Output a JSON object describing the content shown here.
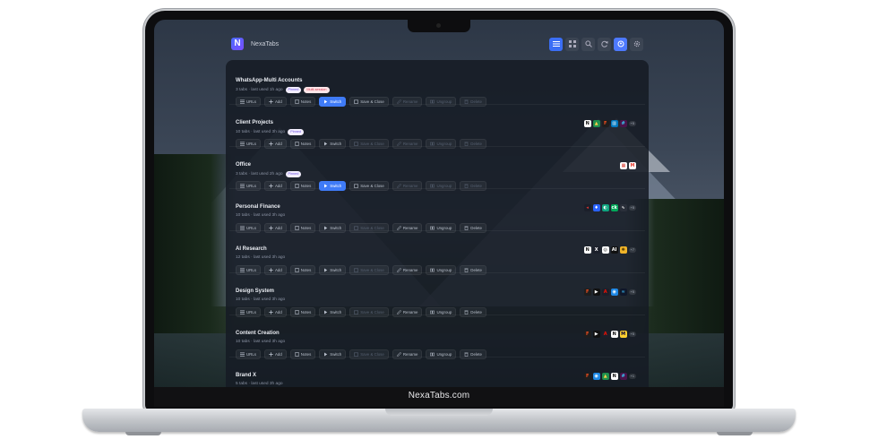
{
  "app": {
    "name": "NexaTabs",
    "logo_letter": "N",
    "footer_text": "NexaTabs.com"
  },
  "toolbar": {
    "buttons": [
      {
        "icon": "list-icon",
        "active": true
      },
      {
        "icon": "grid-icon",
        "active": false
      },
      {
        "icon": "search-icon",
        "active": false
      },
      {
        "icon": "refresh-icon",
        "active": false
      },
      {
        "icon": "profile-icon",
        "active": true
      },
      {
        "icon": "gear-icon",
        "active": false
      }
    ]
  },
  "actions": {
    "urls": "URLs",
    "add": "Add",
    "notes": "Notes",
    "switch": "Switch",
    "save_close": "Save & Close",
    "rename": "Rename",
    "ungroup": "Ungroup",
    "delete": "Delete"
  },
  "groups": [
    {
      "name": "WhatsApp-Multi Accounts",
      "meta": "3 tabs · last used 1h ago",
      "badges": [
        "Pinned",
        "Multi-session"
      ],
      "state": "active",
      "apps": [],
      "more": ""
    },
    {
      "name": "Client Projects",
      "meta": "10 tabs · last used 3h ago",
      "badges": [
        "Pinned"
      ],
      "state": "inactive",
      "apps": [
        "notion",
        "google-drive",
        "figma",
        "trello",
        "slack"
      ],
      "more": "+5"
    },
    {
      "name": "Office",
      "meta": "3 tabs · last used 2h ago",
      "badges": [
        "Pinned"
      ],
      "state": "active",
      "apps": [
        "calendar",
        "gmail"
      ],
      "more": ""
    },
    {
      "name": "Personal Finance",
      "meta": "10 tabs · last used 3h ago",
      "badges": [],
      "state": "normal",
      "apps": [
        "bank",
        "tradingview",
        "coin",
        "ck",
        "chart"
      ],
      "more": "+5"
    },
    {
      "name": "AI Research",
      "meta": "12 tabs · last used 3h ago",
      "badges": [],
      "state": "normal",
      "apps": [
        "notion",
        "x",
        "openai",
        "ai",
        "claude"
      ],
      "more": "+7"
    },
    {
      "name": "Design System",
      "meta": "10 tabs · last used 3h ago",
      "badges": [],
      "state": "normal",
      "apps": [
        "figma",
        "framer",
        "adobe",
        "safari",
        "tailwind"
      ],
      "more": "+5"
    },
    {
      "name": "Content Creation",
      "meta": "10 tabs · last used 3h ago",
      "badges": [],
      "state": "normal",
      "apps": [
        "figma",
        "framer",
        "adobe",
        "notion",
        "miro"
      ],
      "more": "+5"
    },
    {
      "name": "Brand X",
      "meta": "5 tabs · last used 3h ago",
      "badges": [],
      "state": "normal",
      "apps": [
        "figma",
        "safari",
        "google-drive",
        "notion",
        "slack"
      ],
      "more": "+1"
    }
  ],
  "app_icon_styles": {
    "notion": {
      "bg": "#ffffff",
      "fg": "#111111",
      "glyph": "N"
    },
    "google-drive": {
      "bg": "#1f8f4e",
      "fg": "#ffd04b",
      "glyph": "▲"
    },
    "figma": {
      "bg": "#1e1e1e",
      "fg": "#f24e1e",
      "glyph": "F"
    },
    "trello": {
      "bg": "#0079bf",
      "fg": "#ffffff",
      "glyph": "▥"
    },
    "slack": {
      "bg": "#4a154b",
      "fg": "#36c5f0",
      "glyph": "#"
    },
    "calendar": {
      "bg": "#ffffff",
      "fg": "#d93025",
      "glyph": "▦"
    },
    "gmail": {
      "bg": "#ffffff",
      "fg": "#ea4335",
      "glyph": "M"
    },
    "bank": {
      "bg": "#1b1f2a",
      "fg": "#e3342f",
      "glyph": "◂"
    },
    "tradingview": {
      "bg": "#2962ff",
      "fg": "#ffffff",
      "glyph": "♦"
    },
    "coin": {
      "bg": "#0fa47f",
      "fg": "#ffffff",
      "glyph": "◐"
    },
    "ck": {
      "bg": "#00a859",
      "fg": "#ffffff",
      "glyph": "ck"
    },
    "chart": {
      "bg": "#2a2f3a",
      "fg": "#ffffff",
      "glyph": "∿"
    },
    "x": {
      "bg": "#1b1f2a",
      "fg": "#ffffff",
      "glyph": "X"
    },
    "openai": {
      "bg": "#ffffff",
      "fg": "#111111",
      "glyph": "◎"
    },
    "ai": {
      "bg": "#111111",
      "fg": "#ffffff",
      "glyph": "AI"
    },
    "claude": {
      "bg": "#f0b429",
      "fg": "#5a3d00",
      "glyph": "✺"
    },
    "framer": {
      "bg": "#111111",
      "fg": "#ffffff",
      "glyph": "▶"
    },
    "adobe": {
      "bg": "#1b1f2a",
      "fg": "#fa0f00",
      "glyph": "A"
    },
    "safari": {
      "bg": "#1e88e5",
      "fg": "#ffffff",
      "glyph": "◉"
    },
    "tailwind": {
      "bg": "#0f172a",
      "fg": "#38bdf8",
      "glyph": "≈"
    },
    "miro": {
      "bg": "#ffd02f",
      "fg": "#050038",
      "glyph": "M"
    }
  },
  "colors": {
    "accent": "#3f7bf7",
    "panel_bg": "#161b24"
  }
}
